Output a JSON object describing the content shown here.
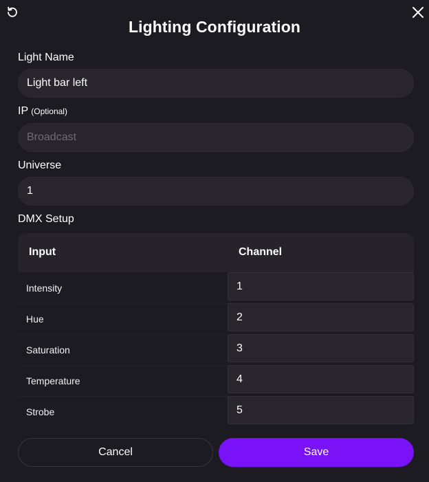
{
  "dialog": {
    "title": "Lighting Configuration",
    "reset_icon": "reset-icon",
    "close_icon": "close-icon"
  },
  "fields": {
    "name": {
      "label": "Light Name",
      "value": "Light bar left"
    },
    "ip": {
      "label": "IP",
      "hint": "(Optional)",
      "value": "",
      "placeholder": "Broadcast"
    },
    "universe": {
      "label": "Universe",
      "value": "1"
    }
  },
  "dmx": {
    "label": "DMX Setup",
    "headers": {
      "input": "Input",
      "channel": "Channel"
    },
    "rows": [
      {
        "name": "Intensity",
        "channel": "1"
      },
      {
        "name": "Hue",
        "channel": "2"
      },
      {
        "name": "Saturation",
        "channel": "3"
      },
      {
        "name": "Temperature",
        "channel": "4"
      },
      {
        "name": "Strobe",
        "channel": "5"
      }
    ]
  },
  "actions": {
    "cancel": "Cancel",
    "save": "Save"
  },
  "colors": {
    "background": "#1d1b22",
    "field": "#28252d",
    "accent": "#7a12f7"
  }
}
